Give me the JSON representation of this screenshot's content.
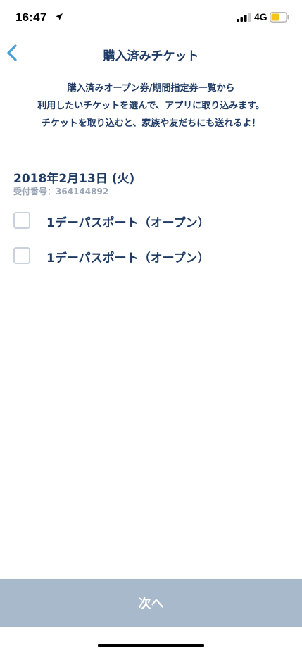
{
  "status_bar": {
    "time": "16:47",
    "network": "4G",
    "battery_color": "#f5c518"
  },
  "nav": {
    "title": "購入済みチケット"
  },
  "intro": {
    "line1": "購入済みオープン券/期間指定券一覧から",
    "line2": "利用したいチケットを選んで、アプリに取り込みます。",
    "line3": "チケットを取り込むと、家族や友だちにも送れるよ！"
  },
  "purchase": {
    "date": "2018年2月13日 (火)",
    "receipt_label": "受付番号：",
    "receipt_number": "364144892",
    "tickets": [
      {
        "label": "1デーパスポート（オープン）",
        "checked": false
      },
      {
        "label": "1デーパスポート（オープン）",
        "checked": false
      }
    ]
  },
  "footer": {
    "next_label": "次へ"
  },
  "colors": {
    "primary_text": "#1f3b64",
    "accent_blue": "#4a9fd8",
    "button_disabled": "#a8b9cc",
    "muted_text": "#9aa6b6"
  }
}
